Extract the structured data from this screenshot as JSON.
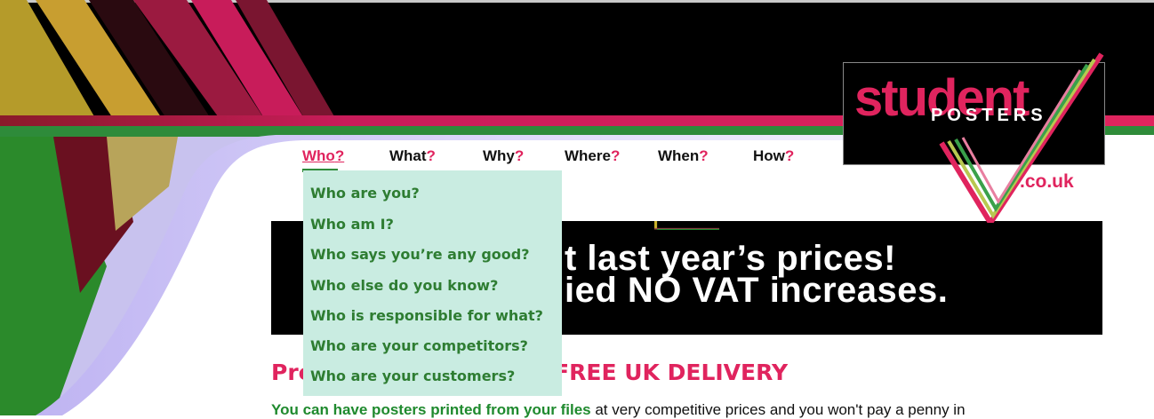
{
  "logo": {
    "word1": "student",
    "word2": "POSTERS",
    "tld": ".co.uk"
  },
  "nav": {
    "items": [
      {
        "label": "Who",
        "q": "?"
      },
      {
        "label": "What",
        "q": "?"
      },
      {
        "label": "Why",
        "q": "?"
      },
      {
        "label": "Where",
        "q": "?"
      },
      {
        "label": "When",
        "q": "?"
      },
      {
        "label": "How",
        "q": "?"
      }
    ],
    "active": "Who"
  },
  "dropdown": {
    "items": [
      "Who are you?",
      "Who am I?",
      "Who says you’re any good?",
      "Who else do you know?",
      "Who is responsible for what?",
      "Who are your competitors?",
      "Who are your customers?"
    ]
  },
  "banner": {
    "line1": "t last year’s prices!",
    "line2": "ied NO VAT increases."
  },
  "headline": {
    "left": "Pre",
    "right": "th FREE UK DELIVERY"
  },
  "body": {
    "lead": "You can have posters printed from your files",
    "rest": " at very competitive prices and you won't pay a penny in"
  },
  "colors": {
    "pink": "#e0245e",
    "green": "#2e8b3a",
    "mint": "#c9ece1",
    "black": "#000000"
  }
}
